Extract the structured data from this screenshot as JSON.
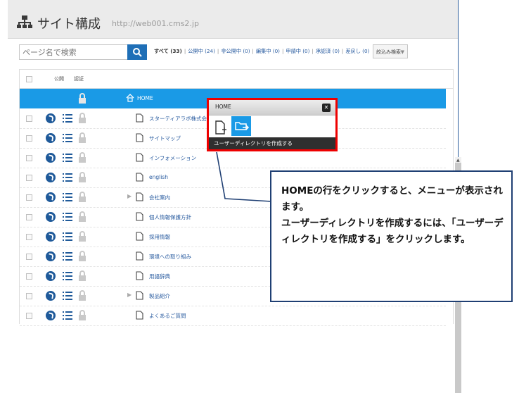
{
  "header": {
    "title": "サイト構成",
    "url": "http://web001.cms2.jp"
  },
  "search": {
    "placeholder": "ページ名で検索"
  },
  "filters": [
    "すべて (33)",
    "公開中 (24)",
    "非公開中 (0)",
    "編集中 (0)",
    "申請中 (0)",
    "承認済 (0)",
    "差戻し (0)"
  ],
  "narrow_button": "絞込み検索",
  "table": {
    "headers": [
      "公開",
      "認証"
    ],
    "home_row": "HOME",
    "rows": [
      {
        "name": "スターティアラボ株式会社",
        "expandable": false
      },
      {
        "name": "サイトマップ",
        "expandable": false
      },
      {
        "name": "インフォメーション",
        "expandable": false
      },
      {
        "name": "english",
        "expandable": false
      },
      {
        "name": "会社案内",
        "expandable": true
      },
      {
        "name": "個人情報保護方針",
        "expandable": false
      },
      {
        "name": "採用情報",
        "expandable": false
      },
      {
        "name": "環境への取り組み",
        "expandable": false
      },
      {
        "name": "用語辞典",
        "expandable": false
      },
      {
        "name": "製品紹介",
        "expandable": true
      },
      {
        "name": "よくあるご質問",
        "expandable": false
      }
    ]
  },
  "popup": {
    "title": "HOME",
    "close_icon": "close-icon",
    "tooltip": "ユーザーディレクトリを作成する"
  },
  "callout": {
    "text": "HOMEの行をクリックすると、メニューが表示されます。\nユーザーディレクトリを作成するには、「ユーザーディレクトリを作成する」をクリックします。"
  },
  "colors": {
    "accent": "#1a9ae6",
    "button": "#1f6fb7",
    "highlight_border": "#ee0000",
    "callout_border": "#1f3f73"
  }
}
